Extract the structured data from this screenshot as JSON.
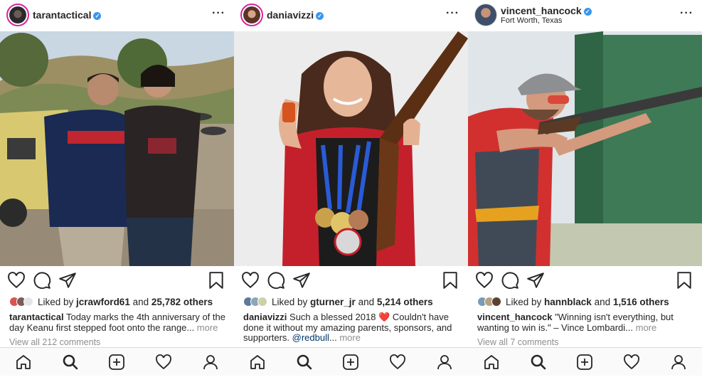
{
  "posts": [
    {
      "username": "tarantactical",
      "location": "",
      "liked_by_prefix": "Liked by ",
      "liked_by_user": "jcrawford61",
      "liked_by_and": " and ",
      "liked_by_count": "25,782 others",
      "caption_user": "tarantactical",
      "caption_text": " Today marks the 4th anniversary of the day Keanu first stepped foot onto the range...",
      "caption_more": " more",
      "view_comments": "View all 212 comments",
      "image_description_icon": "photo-two-men-at-shooting-range"
    },
    {
      "username": "daniavizzi",
      "location": "",
      "liked_by_prefix": "Liked by ",
      "liked_by_user": "gturner_jr",
      "liked_by_and": " and ",
      "liked_by_count": "5,214 others",
      "caption_user": "daniavizzi",
      "caption_text_1": " Such a blessed 2018 ",
      "caption_emoji": "❤️",
      "caption_text_2": " Couldn't have done it without my amazing parents, sponsors, and supporters. ",
      "caption_mention": "@redbull",
      "caption_text_3": "...",
      "caption_more": " more",
      "view_comments": "",
      "image_description_icon": "photo-woman-with-medals-and-shotgun"
    },
    {
      "username": "vincent_hancock",
      "location": "Fort Worth, Texas",
      "liked_by_prefix": "Liked by ",
      "liked_by_user": "hannblack",
      "liked_by_and": " and ",
      "liked_by_count": "1,516 others",
      "caption_user": "vincent_hancock",
      "caption_text": " \"Winning isn't everything, but wanting to win is.\" – Vince Lombardi...",
      "caption_more": " more",
      "view_comments": "View all 7 comments",
      "image_description_icon": "photo-man-aiming-shotgun"
    }
  ],
  "colors": {
    "verified": "#3897f0",
    "story_ring": "#d6249f",
    "muted_text": "#8e8e8e",
    "mention": "#003569",
    "heart": "#ed4956"
  },
  "tabbar_icons": [
    "home-icon",
    "search-icon",
    "new-post-icon",
    "activity-heart-icon",
    "profile-icon"
  ]
}
